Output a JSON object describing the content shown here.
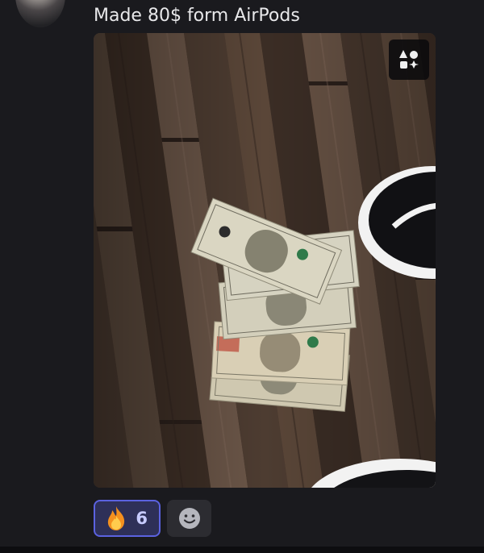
{
  "message": {
    "text": "Made 80$ form AirPods"
  },
  "attachment": {
    "description_icon": "media-effects-icon"
  },
  "reactions": [
    {
      "emoji": "fire-emoji-icon",
      "count": "6",
      "active": true
    }
  ],
  "add_reaction": {
    "icon": "smiley-face-icon"
  },
  "colors": {
    "background": "#1a1a1e",
    "reaction_active_bg": "#2e3058",
    "reaction_active_border": "#5b62e0",
    "reaction_count": "#c7cbff",
    "text": "#e8e8ea"
  }
}
